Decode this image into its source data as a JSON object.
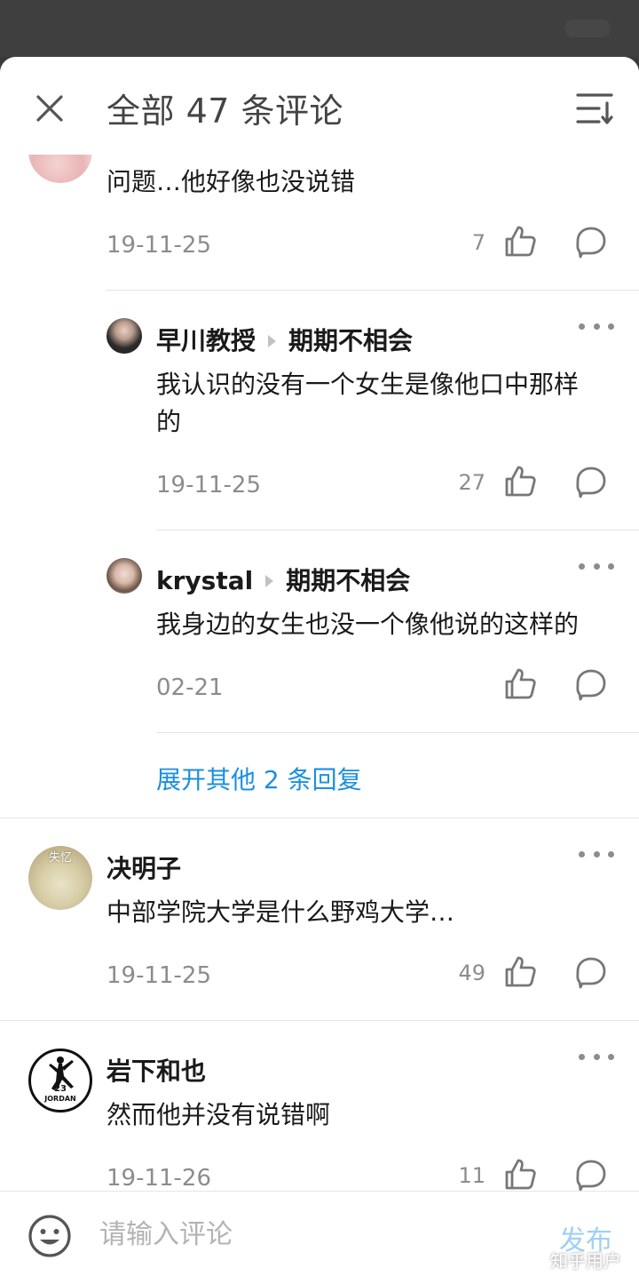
{
  "header": {
    "title": "全部 47 条评论",
    "close_icon": "close-icon",
    "sort_icon": "sort-icon"
  },
  "comments": [
    {
      "text": "问题…他好像也没说错",
      "date": "19-11-25",
      "likes": "7"
    },
    {
      "author": "早川教授",
      "reply_to": "期期不相会",
      "text_line1": "我认识的没有一个女生是像他口中那样",
      "text_line2": "的",
      "date": "19-11-25",
      "likes": "27"
    },
    {
      "author": "krystal",
      "reply_to": "期期不相会",
      "text": "我身边的女生也没一个像他说的这样的",
      "date": "02-21",
      "likes": ""
    },
    {
      "expand_label": "展开其他 2 条回复"
    },
    {
      "author": "决明子",
      "avatar_badge": "失忆",
      "text": "中部学院大学是什么野鸡大学…",
      "date": "19-11-25",
      "likes": "49"
    },
    {
      "author": "岩下和也",
      "avatar_badge": "JORDAN",
      "avatar_number": "23",
      "text": "然而他并没有说错啊",
      "date": "19-11-26",
      "likes": "11"
    }
  ],
  "footer": {
    "input_placeholder": "请输入评论",
    "publish_label": "发布",
    "watermark": "知乎用户"
  },
  "colors": {
    "link": "#1a8fe0",
    "publish_disabled": "#9fd0f3",
    "secondary_text": "#8c8c8c",
    "divider": "#e5e5e5"
  }
}
